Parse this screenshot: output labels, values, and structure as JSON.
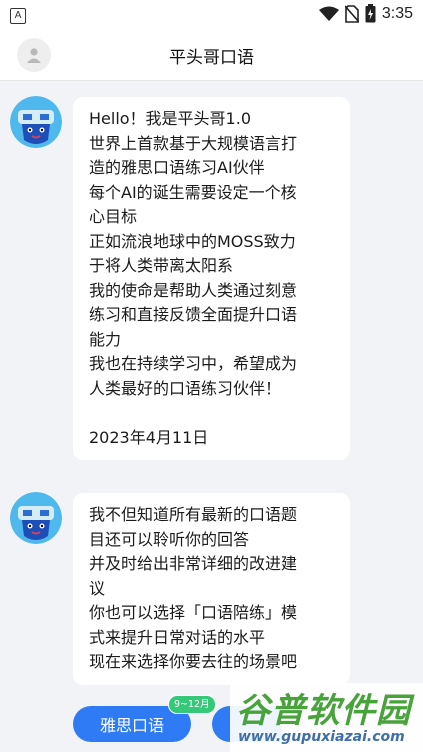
{
  "status_bar": {
    "left_icon_letter": "A",
    "time": "3:35",
    "icons": [
      "wifi-icon",
      "no-sim-icon",
      "battery-icon"
    ]
  },
  "header": {
    "title": "平头哥口语",
    "avatar_icon": "user-icon"
  },
  "messages": [
    {
      "lines": [
        "Hello！我是平头哥1.0",
        "世界上首款基于大规模语言打",
        "造的雅思口语练习AI伙伴",
        "每个AI的诞生需要设定一个核",
        "心目标",
        "正如流浪地球中的MOSS致力",
        "于将人类带离太阳系",
        "我的使命是帮助人类通过刻意",
        "练习和直接反馈全面提升口语",
        "能力",
        "我也在持续学习中，希望成为",
        "人类最好的口语练习伙伴！",
        "",
        "2023年4月11日"
      ]
    },
    {
      "lines": [
        "我不但知道所有最新的口语题",
        "目还可以聆听你的回答",
        "并及时给出非常详细的改进建",
        "议",
        "你也可以选择「口语陪练」模",
        "式来提升日常对话的水平",
        "现在来选择你要去往的场景吧"
      ]
    }
  ],
  "options": {
    "ielts_button": "雅思口语",
    "ielts_tag": "9~12月"
  },
  "watermark": {
    "title": "谷普软件园",
    "url": "www.gupuxiazai.com"
  },
  "colors": {
    "primary": "#2f7bf5",
    "tag": "#36c879",
    "background": "#f2f3f6"
  }
}
